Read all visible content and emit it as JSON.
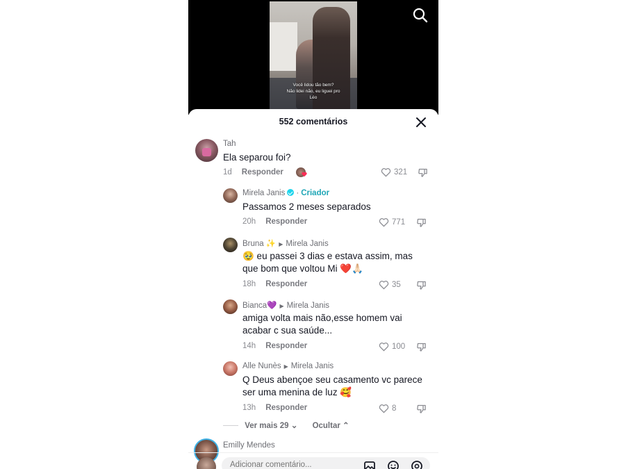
{
  "video": {
    "caption_line1": "Você lidou tão bem?",
    "caption_line2": "Não lidei não, eu liguei pro",
    "caption_line3": "Léo"
  },
  "header": {
    "count_label": "552 comentários",
    "search_icon": "search-icon",
    "close_icon": "close-icon"
  },
  "comments": [
    {
      "user": "Tah",
      "text": "Ela separou foi?",
      "time": "1d",
      "reply_label": "Responder",
      "likes": "321"
    },
    {
      "user": "Mirela Janis",
      "badge": "Criador",
      "text": "Passamos 2 meses separados",
      "time": "20h",
      "reply_label": "Responder",
      "likes": "771"
    },
    {
      "user": "Bruna ✨",
      "reply_to": "Mirela Janis",
      "text_line1": "🥹 eu passei 3 dias e estava assim, mas",
      "text_line2": "que bom que voltou Mi ❤️🙏🏻",
      "time": "18h",
      "reply_label": "Responder",
      "likes": "35"
    },
    {
      "user": "Bianca💜",
      "reply_to": "Mirela Janis",
      "text_line1": "amiga volta mais não,esse homem vai",
      "text_line2": "acabar c sua saúde...",
      "time": "14h",
      "reply_label": "Responder",
      "likes": "100"
    },
    {
      "user": "Alle Nunès",
      "reply_to": "Mirela Janis",
      "text_line1": "Q Deus abençoe seu casamento vc parece",
      "text_line2": "ser uma menina de luz 🥰",
      "time": "13h",
      "reply_label": "Responder",
      "likes": "8"
    }
  ],
  "thread_controls": {
    "more_label": "Ver mais 29",
    "hide_label": "Ocultar"
  },
  "next_comment": {
    "user": "Emilly Mendes"
  },
  "input": {
    "placeholder": "Adicionar comentário..."
  },
  "colors": {
    "creator_accent": "#1fa6b6",
    "verified_badge": "#20d5ec",
    "heart_emoji": "#e0245e"
  }
}
